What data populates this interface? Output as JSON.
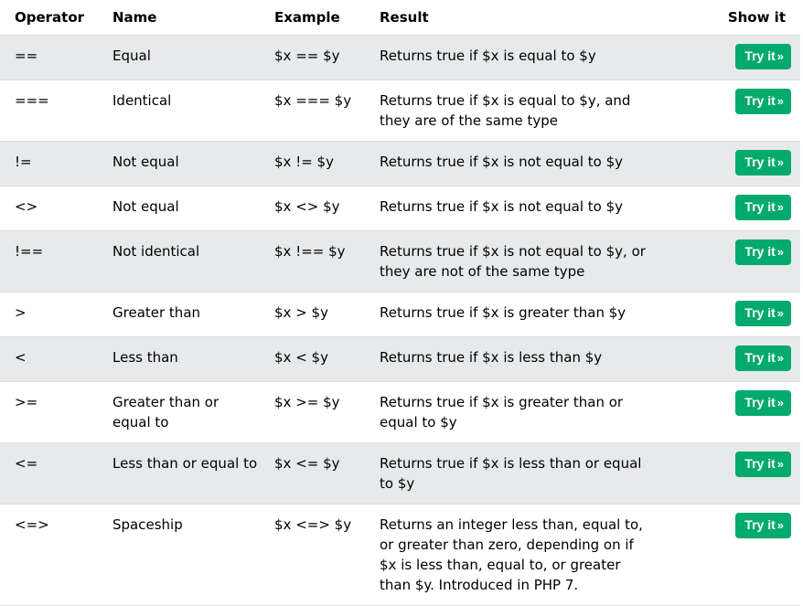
{
  "table": {
    "headers": {
      "operator": "Operator",
      "name": "Name",
      "example": "Example",
      "result": "Result",
      "show": "Show it"
    },
    "button_label": "Try it",
    "button_arrow": "»",
    "rows": [
      {
        "operator": "==",
        "name": "Equal",
        "example": "$x == $y",
        "result": "Returns true if $x is equal to $y"
      },
      {
        "operator": "===",
        "name": "Identical",
        "example": "$x === $y",
        "result": "Returns true if $x is equal to $y, and they are of the same type"
      },
      {
        "operator": "!=",
        "name": "Not equal",
        "example": "$x != $y",
        "result": "Returns true if $x is not equal to $y"
      },
      {
        "operator": "<>",
        "name": "Not equal",
        "example": "$x <> $y",
        "result": "Returns true if $x is not equal to $y"
      },
      {
        "operator": "!==",
        "name": "Not identical",
        "example": "$x !== $y",
        "result": "Returns true if $x is not equal to $y, or they are not of the same type"
      },
      {
        "operator": ">",
        "name": "Greater than",
        "example": "$x > $y",
        "result": "Returns true if $x is greater than $y"
      },
      {
        "operator": "<",
        "name": "Less than",
        "example": "$x < $y",
        "result": "Returns true if $x is less than $y"
      },
      {
        "operator": ">=",
        "name": "Greater than or equal to",
        "example": "$x >= $y",
        "result": "Returns true if $x is greater than or equal to $y"
      },
      {
        "operator": "<=",
        "name": "Less than or equal to",
        "example": "$x <= $y",
        "result": "Returns true if $x is less than or equal to $y"
      },
      {
        "operator": "<=>",
        "name": "Spaceship",
        "example": "$x <=> $y",
        "result": "Returns an integer less than, equal to, or greater than zero, depending on if $x is less than, equal to, or greater than $y. Introduced in PHP 7."
      }
    ]
  }
}
